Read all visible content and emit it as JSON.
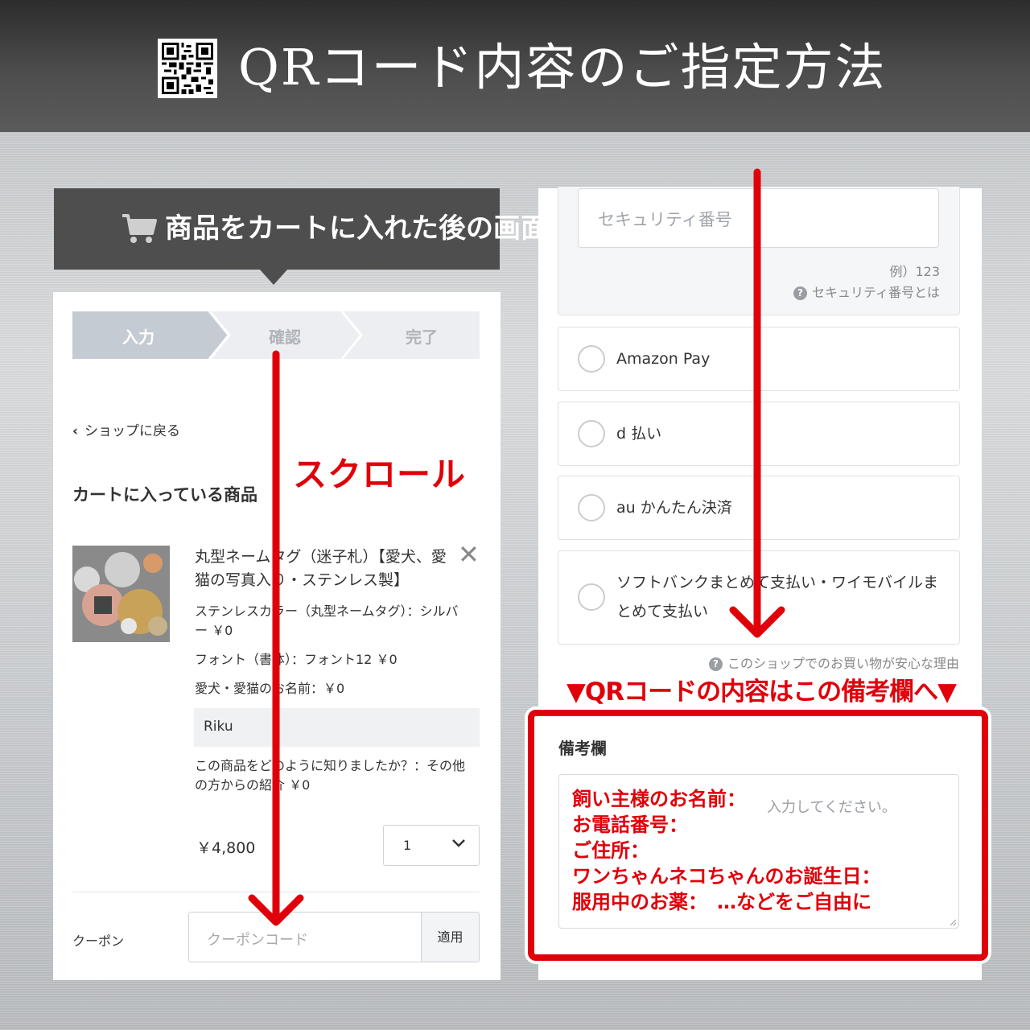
{
  "header": {
    "title": "QRコード内容のご指定方法",
    "icon": "qr-code-icon"
  },
  "caption": {
    "text": "商品をカートに入れた後の画面",
    "icon": "cart-icon"
  },
  "left": {
    "steps": [
      "入力",
      "確認",
      "完了"
    ],
    "active_step": 0,
    "back_link": "ショップに戻る",
    "cart_heading": "カートに入っている商品",
    "product": {
      "name": "丸型ネームタグ（迷子札）【愛犬、愛猫の写真入り・ステンレス製】",
      "options": [
        "ステンレスカラー（丸型ネームタグ）：シルバー ￥0",
        "フォント（書体）：フォント12 ￥0",
        "愛犬・愛猫のお名前：￥0"
      ],
      "name_value": "Riku",
      "referral": "この商品をどのように知りましたか？：その他の方からの紹介 ￥0",
      "price": "￥4,800",
      "quantity": "1"
    },
    "coupon": {
      "label": "クーポン",
      "placeholder": "クーポンコード",
      "apply": "適用"
    }
  },
  "right": {
    "security": {
      "placeholder": "セキュリティ番号",
      "example": "例）123",
      "help": "セキュリティ番号とは"
    },
    "payments": [
      "Amazon Pay",
      "d 払い",
      "au かんたん決済",
      "ソフトバンクまとめて支払い・ワイモバイルまとめて支払い"
    ],
    "reason": "このショップでのお買い物が安心な理由",
    "banner": "▼QRコードの内容はこの備考欄へ▼",
    "memo": {
      "title": "備考欄",
      "placeholder": "入力してください。",
      "lines": [
        "飼い主様のお名前：",
        "お電話番号：",
        "ご住所：",
        "ワンちゃんネコちゃんのお誕生日：",
        "服用中のお薬：　…などをご自由に"
      ]
    }
  },
  "annotation": {
    "scroll": "スクロール"
  },
  "colors": {
    "accent_red": "#e0000a",
    "header_dark": "#3a3a3a",
    "step_active": "#c5cbd3",
    "step_inactive": "#eceef1"
  }
}
